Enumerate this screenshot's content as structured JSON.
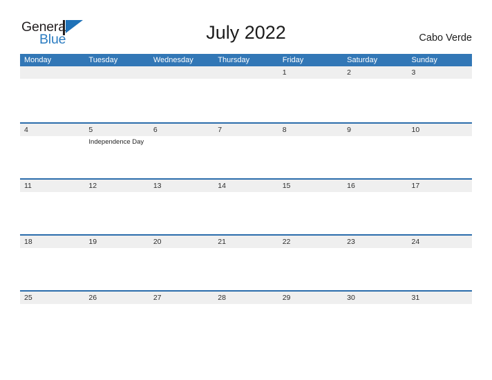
{
  "brand": {
    "name_top": "General",
    "name_bottom": "Blue",
    "mark_icon": "flag-triangle-icon",
    "color_top": "#231f20",
    "color_bottom": "#2b7cc1",
    "mark_color": "#1f72b8"
  },
  "header": {
    "title": "July 2022",
    "region": "Cabo Verde"
  },
  "colors": {
    "weekday_header_bg": "#3277b6",
    "weekday_header_text": "#ffffff",
    "date_band_bg": "#efefef",
    "row_divider": "#2a6cab",
    "cell_bg": "#ffffff",
    "date_text": "#2c2c2c",
    "event_text": "#1f1f1f"
  },
  "calendar": {
    "weekdays": [
      "Monday",
      "Tuesday",
      "Wednesday",
      "Thursday",
      "Friday",
      "Saturday",
      "Sunday"
    ],
    "weeks": [
      [
        {
          "day": "",
          "events": []
        },
        {
          "day": "",
          "events": []
        },
        {
          "day": "",
          "events": []
        },
        {
          "day": "",
          "events": []
        },
        {
          "day": "1",
          "events": []
        },
        {
          "day": "2",
          "events": []
        },
        {
          "day": "3",
          "events": []
        }
      ],
      [
        {
          "day": "4",
          "events": []
        },
        {
          "day": "5",
          "events": [
            "Independence Day"
          ]
        },
        {
          "day": "6",
          "events": []
        },
        {
          "day": "7",
          "events": []
        },
        {
          "day": "8",
          "events": []
        },
        {
          "day": "9",
          "events": []
        },
        {
          "day": "10",
          "events": []
        }
      ],
      [
        {
          "day": "11",
          "events": []
        },
        {
          "day": "12",
          "events": []
        },
        {
          "day": "13",
          "events": []
        },
        {
          "day": "14",
          "events": []
        },
        {
          "day": "15",
          "events": []
        },
        {
          "day": "16",
          "events": []
        },
        {
          "day": "17",
          "events": []
        }
      ],
      [
        {
          "day": "18",
          "events": []
        },
        {
          "day": "19",
          "events": []
        },
        {
          "day": "20",
          "events": []
        },
        {
          "day": "21",
          "events": []
        },
        {
          "day": "22",
          "events": []
        },
        {
          "day": "23",
          "events": []
        },
        {
          "day": "24",
          "events": []
        }
      ],
      [
        {
          "day": "25",
          "events": []
        },
        {
          "day": "26",
          "events": []
        },
        {
          "day": "27",
          "events": []
        },
        {
          "day": "28",
          "events": []
        },
        {
          "day": "29",
          "events": []
        },
        {
          "day": "30",
          "events": []
        },
        {
          "day": "31",
          "events": []
        }
      ]
    ]
  }
}
